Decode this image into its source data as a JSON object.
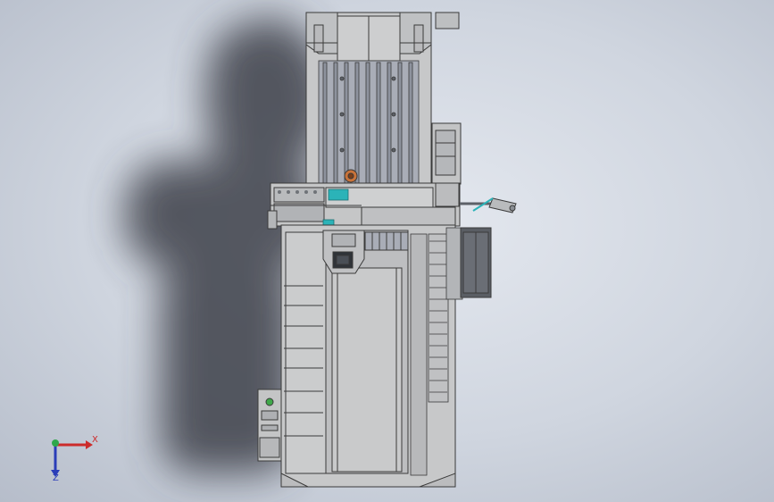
{
  "viewport": {
    "background_color": "#d5dae3",
    "part_fill": "#c7c8c9",
    "part_stroke": "#3a3a3a",
    "rail_fill": "#a8acb6",
    "accent_cyan": "#2bb3b8",
    "accent_orange": "#c8733a"
  },
  "triad": {
    "x_label": "X",
    "z_label": "Z",
    "x_color": "#cc2b2b",
    "y_color": "#2fa84a",
    "z_color": "#2a3db8"
  }
}
